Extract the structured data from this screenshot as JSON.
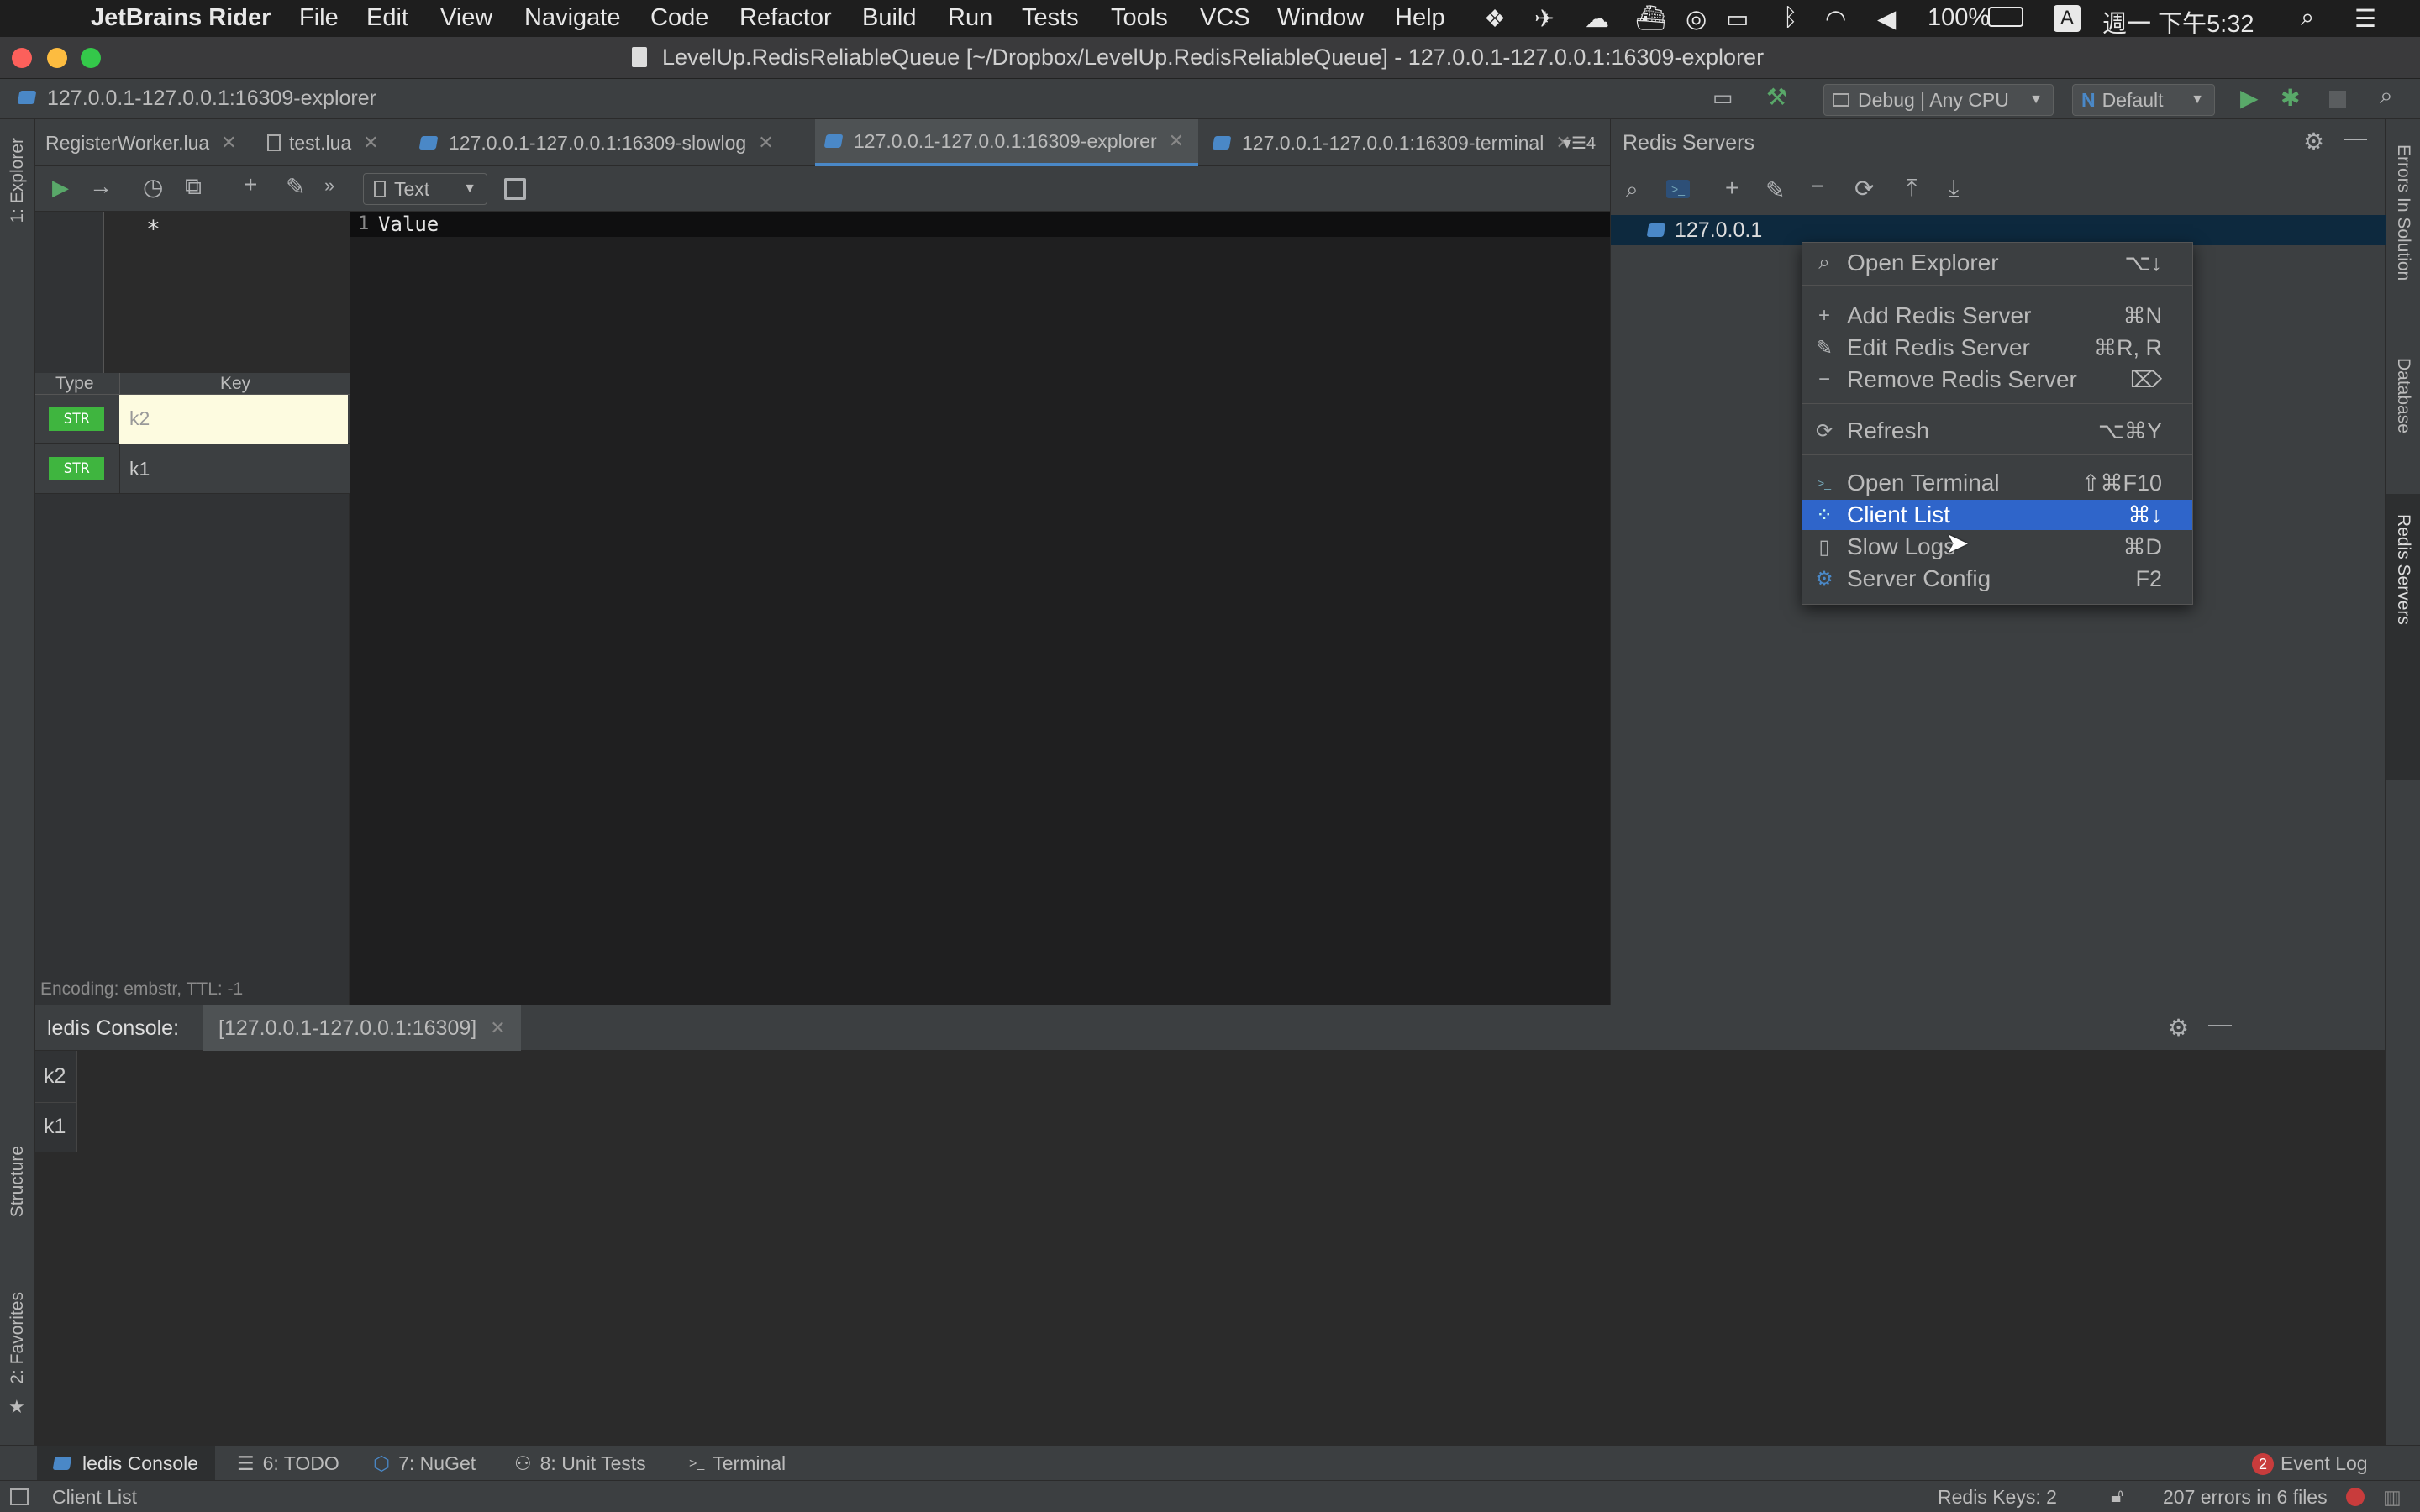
{
  "menubar": {
    "app_name": "JetBrains Rider",
    "menus": [
      "File",
      "Edit",
      "View",
      "Navigate",
      "Code",
      "Refactor",
      "Build",
      "Run",
      "Tests",
      "Tools",
      "VCS",
      "Window",
      "Help"
    ],
    "battery": "100%",
    "input_source": "A",
    "clock": "週一 下午5:32"
  },
  "window": {
    "title": "LevelUp.RedisReliableQueue [~/Dropbox/LevelUp.RedisReliableQueue] - 127.0.0.1-127.0.0.1:16309-explorer"
  },
  "toolbar": {
    "breadcrumb": "127.0.0.1-127.0.0.1:16309-explorer",
    "config": "Debug | Any CPU",
    "run_target": "Default"
  },
  "left_strip": {
    "explorer": "1: Explorer",
    "structure": "Structure",
    "favorites": "2: Favorites"
  },
  "right_strip": {
    "errors": "Errors In Solution",
    "database": "Database",
    "redis": "Redis Servers"
  },
  "tabs": [
    {
      "label": "RegisterWorker.lua"
    },
    {
      "label": "test.lua"
    },
    {
      "label": "127.0.0.1-127.0.0.1:16309-slowlog"
    },
    {
      "label": "127.0.0.1-127.0.0.1:16309-explorer"
    },
    {
      "label": "127.0.0.1-127.0.0.1:16309-terminal"
    }
  ],
  "tabs_overflow": "4",
  "editor_toolbar": {
    "format": "Text"
  },
  "explorer": {
    "filter": "*",
    "col_type": "Type",
    "col_key": "Key",
    "rows": [
      {
        "type": "STR",
        "key": "k2"
      },
      {
        "type": "STR",
        "key": "k1"
      }
    ],
    "encoding_info": "Encoding: embstr, TTL: -1"
  },
  "value_editor": {
    "line_no": "1",
    "text": "Value"
  },
  "redis_panel": {
    "title": "Redis Servers",
    "server": "127.0.0.1"
  },
  "context_menu": {
    "items": [
      {
        "label": "Open Explorer",
        "shortcut": "⌥↓"
      },
      {
        "label": "Add Redis Server",
        "shortcut": "⌘N"
      },
      {
        "label": "Edit Redis Server",
        "shortcut": "⌘R, R"
      },
      {
        "label": "Remove Redis Server",
        "shortcut": "⌦"
      },
      {
        "label": "Refresh",
        "shortcut": "⌥⌘Y"
      },
      {
        "label": "Open Terminal",
        "shortcut": "⇧⌘F10"
      },
      {
        "label": "Client List",
        "shortcut": "⌘↓"
      },
      {
        "label": "Slow Logs",
        "shortcut": "⌘D"
      },
      {
        "label": "Server Config",
        "shortcut": "F2"
      }
    ]
  },
  "console": {
    "title": "ledis Console:",
    "tab": "[127.0.0.1-127.0.0.1:16309]",
    "lines": [
      "k2",
      "k1"
    ]
  },
  "bottom_tabs": {
    "ledis": "ledis Console",
    "todo": "6: TODO",
    "nuget": "7: NuGet",
    "tests": "8: Unit Tests",
    "terminal": "Terminal",
    "event_log": "Event Log",
    "event_count": "2"
  },
  "status": {
    "message": "Client List",
    "redis_keys": "Redis Keys: 2",
    "errors": "207 errors in 6 files"
  },
  "colors": {
    "accent": "#2f65ca",
    "tab_underline": "#4a88c7",
    "str_badge": "#3fb53f"
  }
}
